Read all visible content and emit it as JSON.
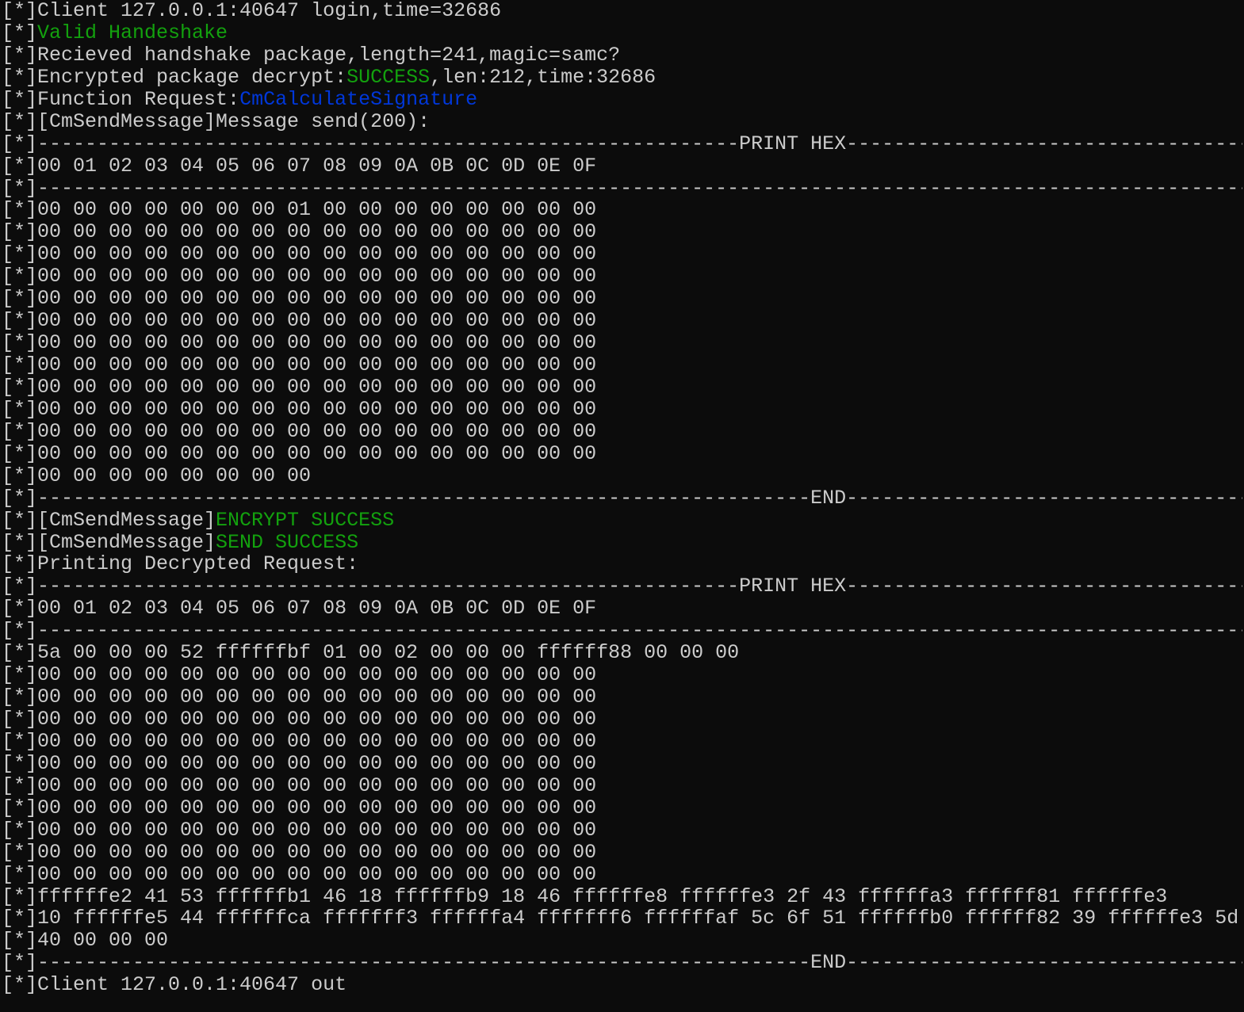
{
  "terminal": {
    "colors": {
      "background": "#0c0c0c",
      "foreground": "#cccccc",
      "green": "#13a10e",
      "blue": "#0037da"
    },
    "lines": [
      [
        {
          "t": "[*]Client 127.0.0.1:40647 login,time=32686",
          "c": "fg"
        }
      ],
      [
        {
          "t": "[*]",
          "c": "fg"
        },
        {
          "t": "Valid Handeshake",
          "c": "green"
        }
      ],
      [
        {
          "t": "[*]Recieved handshake package,length=241,magic=samc?",
          "c": "fg"
        }
      ],
      [
        {
          "t": "[*]Encrypted package decrypt:",
          "c": "fg"
        },
        {
          "t": "SUCCESS",
          "c": "green"
        },
        {
          "t": ",len:212,time:32686",
          "c": "fg"
        }
      ],
      [
        {
          "t": "[*]Function Request:",
          "c": "fg"
        },
        {
          "t": "CmCalculateSignature",
          "c": "blue"
        }
      ],
      [
        {
          "t": "[*][CmSendMessage]Message send(200):",
          "c": "fg"
        }
      ],
      [
        {
          "t": "[*]-----------------------------------------------------------PRINT HEX---------------------------------------------------------------",
          "c": "fg"
        }
      ],
      [
        {
          "t": "[*]00 01 02 03 04 05 06 07 08 09 0A 0B 0C 0D 0E 0F",
          "c": "fg"
        }
      ],
      [
        {
          "t": "[*]--------------------------------------------------------------------------------------------------------------------------------------------",
          "c": "fg"
        }
      ],
      [
        {
          "t": "[*]00 00 00 00 00 00 00 01 00 00 00 00 00 00 00 00",
          "c": "fg"
        }
      ],
      [
        {
          "t": "[*]00 00 00 00 00 00 00 00 00 00 00 00 00 00 00 00",
          "c": "fg"
        }
      ],
      [
        {
          "t": "[*]00 00 00 00 00 00 00 00 00 00 00 00 00 00 00 00",
          "c": "fg"
        }
      ],
      [
        {
          "t": "[*]00 00 00 00 00 00 00 00 00 00 00 00 00 00 00 00",
          "c": "fg"
        }
      ],
      [
        {
          "t": "[*]00 00 00 00 00 00 00 00 00 00 00 00 00 00 00 00",
          "c": "fg"
        }
      ],
      [
        {
          "t": "[*]00 00 00 00 00 00 00 00 00 00 00 00 00 00 00 00",
          "c": "fg"
        }
      ],
      [
        {
          "t": "[*]00 00 00 00 00 00 00 00 00 00 00 00 00 00 00 00",
          "c": "fg"
        }
      ],
      [
        {
          "t": "[*]00 00 00 00 00 00 00 00 00 00 00 00 00 00 00 00",
          "c": "fg"
        }
      ],
      [
        {
          "t": "[*]00 00 00 00 00 00 00 00 00 00 00 00 00 00 00 00",
          "c": "fg"
        }
      ],
      [
        {
          "t": "[*]00 00 00 00 00 00 00 00 00 00 00 00 00 00 00 00",
          "c": "fg"
        }
      ],
      [
        {
          "t": "[*]00 00 00 00 00 00 00 00 00 00 00 00 00 00 00 00",
          "c": "fg"
        }
      ],
      [
        {
          "t": "[*]00 00 00 00 00 00 00 00 00 00 00 00 00 00 00 00",
          "c": "fg"
        }
      ],
      [
        {
          "t": "[*]00 00 00 00 00 00 00 00",
          "c": "fg"
        }
      ],
      [
        {
          "t": "[*]-----------------------------------------------------------------END---------------------------------------------------------------------",
          "c": "fg"
        }
      ],
      [
        {
          "t": "[*][CmSendMessage]",
          "c": "fg"
        },
        {
          "t": "ENCRYPT SUCCESS",
          "c": "green"
        }
      ],
      [
        {
          "t": "[*][CmSendMessage]",
          "c": "fg"
        },
        {
          "t": "SEND SUCCESS",
          "c": "green"
        }
      ],
      [
        {
          "t": "[*]Printing Decrypted Request:",
          "c": "fg"
        }
      ],
      [
        {
          "t": "[*]-----------------------------------------------------------PRINT HEX---------------------------------------------------------------",
          "c": "fg"
        }
      ],
      [
        {
          "t": "[*]00 01 02 03 04 05 06 07 08 09 0A 0B 0C 0D 0E 0F",
          "c": "fg"
        }
      ],
      [
        {
          "t": "[*]--------------------------------------------------------------------------------------------------------------------------------------------",
          "c": "fg"
        }
      ],
      [
        {
          "t": "[*]5a 00 00 00 52 ffffffbf 01 00 02 00 00 00 ffffff88 00 00 00",
          "c": "fg"
        }
      ],
      [
        {
          "t": "[*]00 00 00 00 00 00 00 00 00 00 00 00 00 00 00 00",
          "c": "fg"
        }
      ],
      [
        {
          "t": "[*]00 00 00 00 00 00 00 00 00 00 00 00 00 00 00 00",
          "c": "fg"
        }
      ],
      [
        {
          "t": "[*]00 00 00 00 00 00 00 00 00 00 00 00 00 00 00 00",
          "c": "fg"
        }
      ],
      [
        {
          "t": "[*]00 00 00 00 00 00 00 00 00 00 00 00 00 00 00 00",
          "c": "fg"
        }
      ],
      [
        {
          "t": "[*]00 00 00 00 00 00 00 00 00 00 00 00 00 00 00 00",
          "c": "fg"
        }
      ],
      [
        {
          "t": "[*]00 00 00 00 00 00 00 00 00 00 00 00 00 00 00 00",
          "c": "fg"
        }
      ],
      [
        {
          "t": "[*]00 00 00 00 00 00 00 00 00 00 00 00 00 00 00 00",
          "c": "fg"
        }
      ],
      [
        {
          "t": "[*]00 00 00 00 00 00 00 00 00 00 00 00 00 00 00 00",
          "c": "fg"
        }
      ],
      [
        {
          "t": "[*]00 00 00 00 00 00 00 00 00 00 00 00 00 00 00 00",
          "c": "fg"
        }
      ],
      [
        {
          "t": "[*]00 00 00 00 00 00 00 00 00 00 00 00 00 00 00 00",
          "c": "fg"
        }
      ],
      [
        {
          "t": "[*]ffffffe2 41 53 ffffffb1 46 18 ffffffb9 18 46 ffffffe8 ffffffe3 2f 43 ffffffa3 ffffff81 ffffffe3",
          "c": "fg"
        }
      ],
      [
        {
          "t": "[*]10 ffffffe5 44 ffffffca fffffff3 ffffffa4 fffffff6 ffffffaf 5c 6f 51 ffffffb0 ffffff82 39 ffffffe3 5d",
          "c": "fg"
        }
      ],
      [
        {
          "t": "[*]40 00 00 00",
          "c": "fg"
        }
      ],
      [
        {
          "t": "[*]-----------------------------------------------------------------END---------------------------------------------------------------------",
          "c": "fg"
        }
      ],
      [
        {
          "t": "[*]Client 127.0.0.1:40647 out",
          "c": "fg"
        }
      ]
    ]
  }
}
